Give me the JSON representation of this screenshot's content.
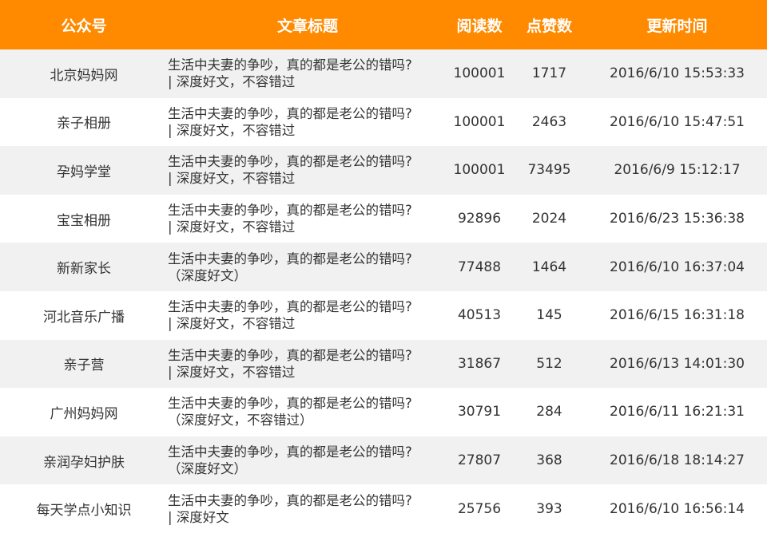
{
  "headers": {
    "account": "公众号",
    "title": "文章标题",
    "reads": "阅读数",
    "likes": "点赞数",
    "updated": "更新时间"
  },
  "colors": {
    "header_bg": "#ff8a00",
    "header_text": "#ffffff",
    "row_alt": "#f1f1f1"
  },
  "rows": [
    {
      "account": "北京妈妈网",
      "title_line1": "生活中夫妻的争吵，真的都是老公的错吗?",
      "title_line2": "| 深度好文，不容错过",
      "reads": "100001",
      "likes": "1717",
      "updated": "2016/6/10 15:53:33"
    },
    {
      "account": "亲子相册",
      "title_line1": "生活中夫妻的争吵，真的都是老公的错吗?",
      "title_line2": "| 深度好文，不容错过",
      "reads": "100001",
      "likes": "2463",
      "updated": "2016/6/10 15:47:51"
    },
    {
      "account": "孕妈学堂",
      "title_line1": "生活中夫妻的争吵，真的都是老公的错吗?",
      "title_line2": "| 深度好文，不容错过",
      "reads": "100001",
      "likes": "73495",
      "updated": "2016/6/9 15:12:17"
    },
    {
      "account": "宝宝相册",
      "title_line1": "生活中夫妻的争吵，真的都是老公的错吗?",
      "title_line2": "| 深度好文，不容错过",
      "reads": "92896",
      "likes": "2024",
      "updated": "2016/6/23 15:36:38"
    },
    {
      "account": "新新家长",
      "title_line1": "生活中夫妻的争吵，真的都是老公的错吗?",
      "title_line2": "（深度好文）",
      "reads": "77488",
      "likes": "1464",
      "updated": "2016/6/10 16:37:04"
    },
    {
      "account": "河北音乐广播",
      "title_line1": "生活中夫妻的争吵，真的都是老公的错吗?",
      "title_line2": "| 深度好文，不容错过",
      "reads": "40513",
      "likes": "145",
      "updated": "2016/6/15 16:31:18"
    },
    {
      "account": "亲子营",
      "title_line1": "生活中夫妻的争吵，真的都是老公的错吗?",
      "title_line2": "| 深度好文，不容错过",
      "reads": "31867",
      "likes": "512",
      "updated": "2016/6/13 14:01:30"
    },
    {
      "account": "广州妈妈网",
      "title_line1": "生活中夫妻的争吵，真的都是老公的错吗?",
      "title_line2": "（深度好文，不容错过）",
      "reads": "30791",
      "likes": "284",
      "updated": "2016/6/11 16:21:31"
    },
    {
      "account": "亲润孕妇护肤",
      "title_line1": "生活中夫妻的争吵，真的都是老公的错吗?",
      "title_line2": "（深度好文）",
      "reads": "27807",
      "likes": "368",
      "updated": "2016/6/18 18:14:27"
    },
    {
      "account": "每天学点小知识",
      "title_line1": "生活中夫妻的争吵，真的都是老公的错吗?",
      "title_line2": "| 深度好文",
      "reads": "25756",
      "likes": "393",
      "updated": "2016/6/10 16:56:14"
    }
  ]
}
